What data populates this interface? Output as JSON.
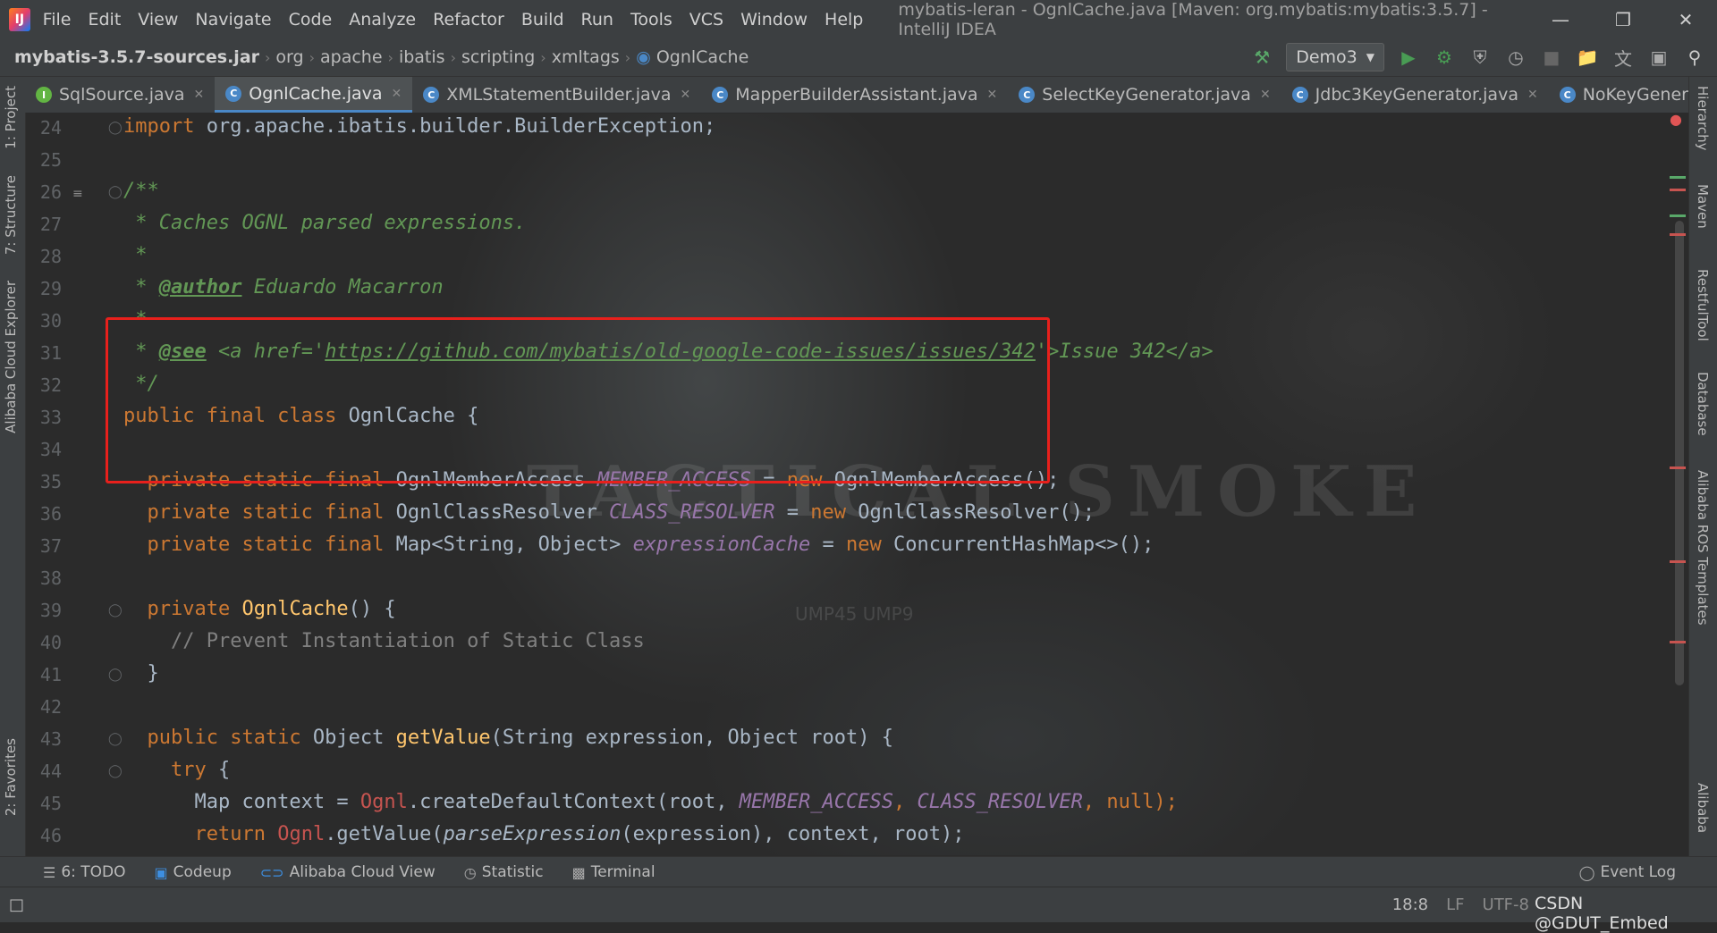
{
  "titlebar": {
    "menu": [
      "File",
      "Edit",
      "View",
      "Navigate",
      "Code",
      "Analyze",
      "Refactor",
      "Build",
      "Run",
      "Tools",
      "VCS",
      "Window",
      "Help"
    ],
    "title": "mybatis-leran - OgnlCache.java [Maven: org.mybatis:mybatis:3.5.7] - IntelliJ IDEA",
    "logo": "IJ"
  },
  "breadcrumb": [
    "mybatis-3.5.7-sources.jar",
    "org",
    "apache",
    "ibatis",
    "scripting",
    "xmltags",
    "OgnlCache"
  ],
  "toolbar": {
    "run_config": "Demo3"
  },
  "tabs": [
    {
      "label": "SqlSource.java",
      "icon": "I"
    },
    {
      "label": "OgnlCache.java",
      "icon": "C",
      "active": true
    },
    {
      "label": "XMLStatementBuilder.java",
      "icon": "C"
    },
    {
      "label": "MapperBuilderAssistant.java",
      "icon": "C"
    },
    {
      "label": "SelectKeyGenerator.java",
      "icon": "C"
    },
    {
      "label": "Jdbc3KeyGenerator.java",
      "icon": "C"
    },
    {
      "label": "NoKeyGenerator.java",
      "icon": "C"
    }
  ],
  "left_tools": [
    "1: Project",
    "7: Structure",
    "Alibaba Cloud Explorer",
    "2: Favorites"
  ],
  "right_tools": [
    "Hierarchy",
    "Maven",
    "RestfulTool",
    "Database",
    "Alibaba ROS Templates",
    "Alibaba"
  ],
  "editor": {
    "line_numbers": [
      "24",
      "25",
      "26",
      "27",
      "28",
      "29",
      "30",
      "31",
      "32",
      "33",
      "34",
      "35",
      "36",
      "37",
      "38",
      "39",
      "40",
      "41",
      "42",
      "43",
      "44",
      "45",
      "46"
    ],
    "lines": {
      "l24": {
        "kw": "import",
        "rest": " org.apache.ibatis.builder.BuilderException;"
      },
      "l26": "/**",
      "l27": " * Caches OGNL parsed expressions.",
      "l28": " *",
      "l29": {
        "pre": " * ",
        "tag": "@author",
        "rest": " Eduardo Macarron"
      },
      "l30": " *",
      "l31": {
        "pre": " * ",
        "tag": "@see",
        "mid": " <a href='",
        "link": "https://github.com/mybatis/old-google-code-issues/issues/342",
        "post": "'>Issue 342</a>"
      },
      "l32": " */",
      "l33": {
        "kw": "public final class",
        "rest": " OgnlCache {"
      },
      "l35": {
        "kw": "  private static final",
        "type": " OgnlMemberAccess ",
        "field": "MEMBER_ACCESS",
        "eq": " = ",
        "new": "new",
        "rest": " OgnlMemberAccess();"
      },
      "l36": {
        "kw": "  private static final",
        "type": " OgnlClassResolver ",
        "field": "CLASS_RESOLVER",
        "eq": " = ",
        "new": "new",
        "rest": " OgnlClassResolver();"
      },
      "l37": {
        "kw": "  private static final",
        "type": " Map<String, Object> ",
        "field": "expressionCache",
        "eq": " = ",
        "new": "new",
        "rest": " ConcurrentHashMap<>();"
      },
      "l39": {
        "kw": "  private",
        "fn": " OgnlCache",
        "rest": "() {"
      },
      "l40": "    // Prevent Instantiation of Static Class",
      "l41": "  }",
      "l43": {
        "kw": "  public static",
        "type": " Object ",
        "fn": "getValue",
        "rest": "(String expression, Object root) {"
      },
      "l44": {
        "kw": "    try",
        "rest": " {"
      },
      "l45": {
        "pre": "      Map context = ",
        "cls": "Ognl",
        "mid": ".createDefaultContext(root, ",
        "f1": "MEMBER_ACCESS",
        ",": ", ",
        "f2": "CLASS_RESOLVER",
        "c2": ", ",
        "nul": "null",
        "end": ");"
      },
      "l46": {
        "kw": "      return",
        "sp": " ",
        "cls": "Ognl",
        "mid": ".getValue(",
        "it": "parseExpression",
        "end": "(expression), context, root);"
      }
    },
    "watermark_bg": "TACTICAL SMOKE",
    "watermark_small": "UMP45  UMP9"
  },
  "bottom_tabs": [
    {
      "label": "6: TODO",
      "icon": "list-icon"
    },
    {
      "label": "Codeup",
      "icon": "codeup-icon"
    },
    {
      "label": "Alibaba Cloud View",
      "icon": "cloud-icon"
    },
    {
      "label": "Statistic",
      "icon": "statistic-icon"
    },
    {
      "label": "Terminal",
      "icon": "terminal-icon"
    }
  ],
  "event_log": "Event Log",
  "status": {
    "position": "18:8",
    "line_sep": "LF",
    "encoding": "UTF-8"
  },
  "credit": "CSDN @GDUT_Embed",
  "colors": {
    "keyword": "#cc7832",
    "javadoc": "#629755",
    "static_field": "#9876aa",
    "method": "#ffc66d",
    "highlight_box": "#e8201c"
  }
}
